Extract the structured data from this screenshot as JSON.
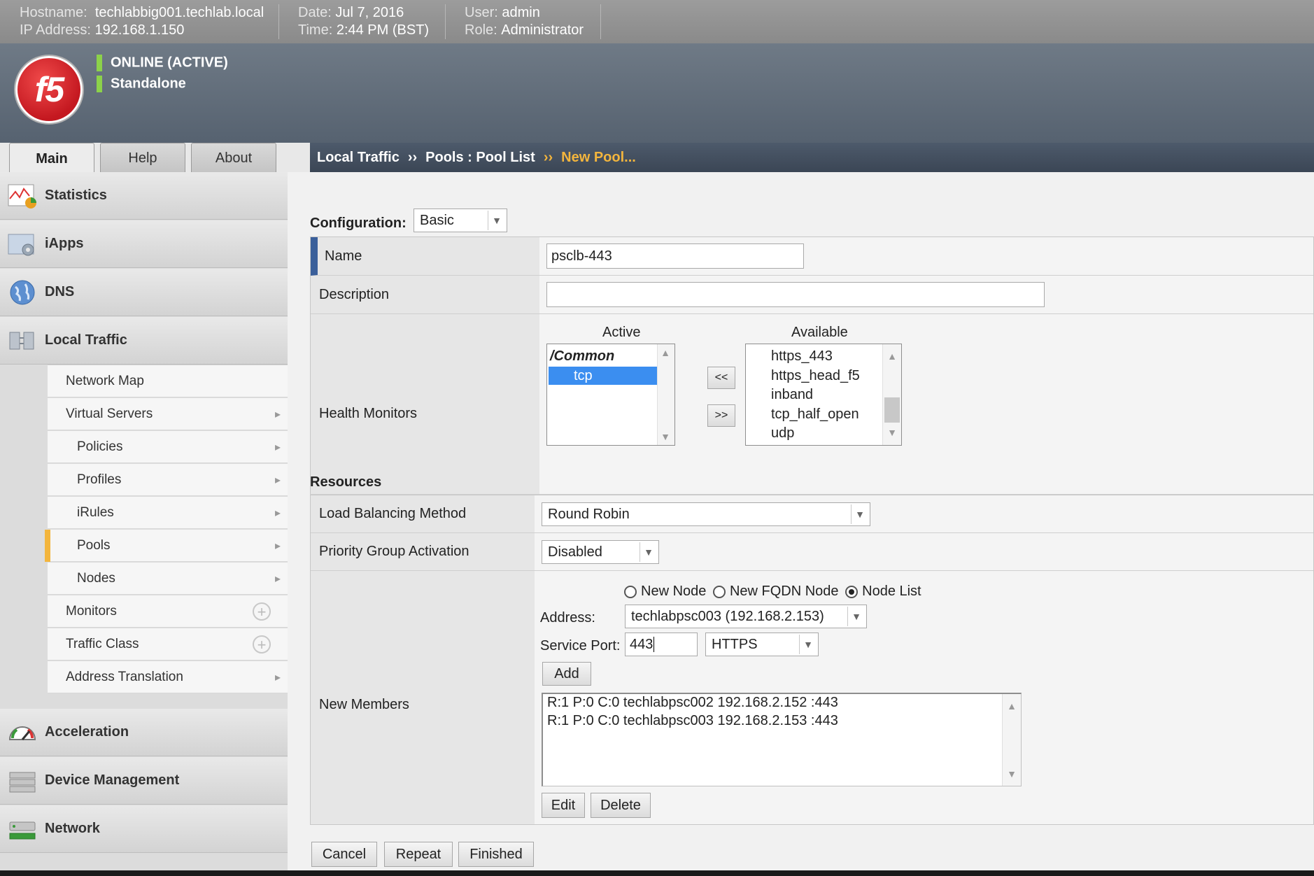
{
  "topbar": {
    "hostname_label": "Hostname:",
    "hostname": "techlabbig001.techlab.local",
    "ip_label": "IP Address:",
    "ip": "192.168.1.150",
    "date_label": "Date:",
    "date": "Jul 7, 2016",
    "time_label": "Time:",
    "time": "2:44 PM (BST)",
    "user_label": "User:",
    "user": "admin",
    "role_label": "Role:",
    "role": "Administrator"
  },
  "banner": {
    "logo_text": "f5",
    "status": "ONLINE (ACTIVE)",
    "mode": "Standalone",
    "status_color": "#8cd24a"
  },
  "tabs": [
    {
      "label": "Main",
      "active": true
    },
    {
      "label": "Help",
      "active": false
    },
    {
      "label": "About",
      "active": false
    }
  ],
  "breadcrumb": {
    "part1": "Local Traffic",
    "part2": "Pools : Pool List",
    "current": "New Pool...",
    "sep": "››"
  },
  "sidebar": {
    "sections": [
      {
        "label": "Statistics",
        "icon": "statistics-icon"
      },
      {
        "label": "iApps",
        "icon": "iapps-icon"
      },
      {
        "label": "DNS",
        "icon": "globe-icon"
      },
      {
        "label": "Local Traffic",
        "icon": "local-traffic-icon"
      }
    ],
    "local_traffic_items": [
      {
        "label": "Network Map"
      },
      {
        "label": "Virtual Servers"
      },
      {
        "label": "Policies"
      },
      {
        "label": "Profiles"
      },
      {
        "label": "iRules"
      },
      {
        "label": "Pools"
      },
      {
        "label": "Nodes"
      },
      {
        "label": "Monitors"
      },
      {
        "label": "Traffic Class"
      },
      {
        "label": "Address Translation"
      }
    ],
    "lower_sections": [
      {
        "label": "Acceleration",
        "icon": "speedometer-icon"
      },
      {
        "label": "Device Management",
        "icon": "device-icon"
      },
      {
        "label": "Network",
        "icon": "network-icon"
      }
    ]
  },
  "form": {
    "configuration_label": "Configuration:",
    "configuration_value": "Basic",
    "name_label": "Name",
    "name_value": "psclb-443",
    "description_label": "Description",
    "description_value": "",
    "health_monitors_label": "Health Monitors",
    "active_header": "Active",
    "available_header": "Available",
    "active_list": [
      "/Common",
      "tcp"
    ],
    "available_list": [
      "https_443",
      "https_head_f5",
      "inband",
      "tcp_half_open",
      "udp"
    ],
    "move_left": "<<",
    "move_right": ">>",
    "resources_title": "Resources",
    "lb_method_label": "Load Balancing Method",
    "lb_method_value": "Round Robin",
    "priority_label": "Priority Group Activation",
    "priority_value": "Disabled",
    "new_members_label": "New Members",
    "radio_new_node": "New Node",
    "radio_fqdn": "New FQDN Node",
    "radio_node_list": "Node List",
    "address_label": "Address:",
    "address_value": "techlabpsc003 (192.168.2.153)",
    "service_port_label": "Service Port:",
    "service_port_value": "443",
    "service_value": "HTTPS",
    "add_label": "Add",
    "members": [
      "R:1 P:0 C:0 techlabpsc002 192.168.2.152 :443",
      "R:1 P:0 C:0 techlabpsc003 192.168.2.153 :443"
    ],
    "edit_label": "Edit",
    "delete_label": "Delete"
  },
  "footer_buttons": {
    "cancel": "Cancel",
    "repeat": "Repeat",
    "finished": "Finished"
  },
  "colors": {
    "accent": "#f3b53d",
    "selection": "#3b8ef0",
    "name_marker": "#3a5f9a"
  }
}
